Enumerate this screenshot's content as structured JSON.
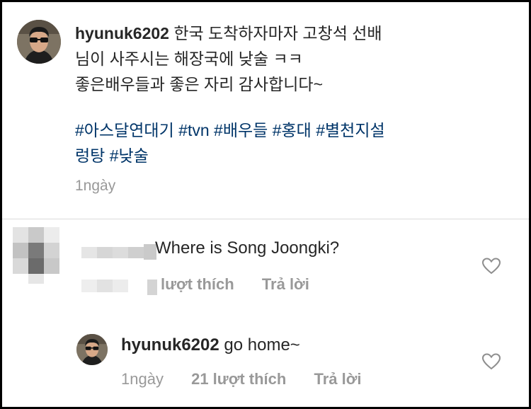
{
  "post": {
    "username": "hyunuk6202",
    "caption_lines": [
      "한국 도착하자마자 고창석 선배",
      "님이 사주시는 해장국에 낮술 ㅋㅋ",
      "좋은배우들과 좋은 자리 감사합니다~"
    ],
    "hashtags": [
      "#아스달연대기",
      "#tvn",
      "#배우들",
      "#홍대",
      "#별천지설",
      "렁탕",
      "#낮술"
    ],
    "time": "1ngày"
  },
  "comment": {
    "text": "Where is Song Joongki?",
    "like_label": "lượt thích",
    "reply_label": "Trả lời"
  },
  "reply": {
    "username": "hyunuk6202",
    "text": "go home~",
    "time": "1ngày",
    "likes": "21 lượt thích",
    "reply_label": "Trả lời"
  },
  "icons": {
    "like": "heart-outline-icon"
  },
  "colors": {
    "text": "#262626",
    "hashtag": "#003569",
    "muted": "#999999",
    "border": "#000000"
  }
}
